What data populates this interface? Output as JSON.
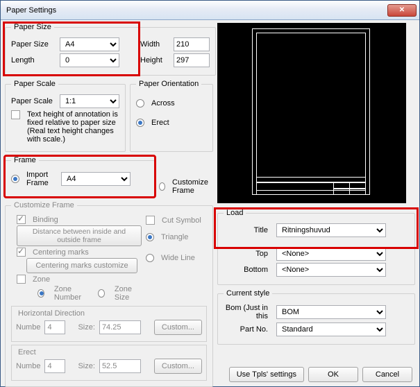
{
  "window": {
    "title": "Paper Settings"
  },
  "paperSize": {
    "legend": "Paper Size",
    "sizeLabel": "Paper Size",
    "sizeValue": "A4",
    "lengthLabel": "Length",
    "lengthValue": "0",
    "widthLabel": "Width",
    "widthValue": "210",
    "heightLabel": "Height",
    "heightValue": "297"
  },
  "paperScale": {
    "legend": "Paper Scale",
    "label": "Paper Scale",
    "value": "1:1",
    "note": "Text height of annotation is fixed relative to paper size (Real text height changes with scale.)"
  },
  "orientation": {
    "legend": "Paper Orientation",
    "across": "Across",
    "erect": "Erect"
  },
  "frame": {
    "legend": "Frame",
    "importLabel": "Import Frame",
    "importValue": "A4",
    "customizeLabel": "Customize Frame"
  },
  "customize": {
    "legend": "Customize Frame",
    "binding": "Binding",
    "distanceBtn": "Distance between inside and outside frame",
    "centering": "Centering marks",
    "centeringCustomize": "Centering marks customize",
    "zone": "Zone",
    "zoneNumber": "Zone Number",
    "zoneSize": "Zone Size",
    "hDir": "Horizontal Direction",
    "erect": "Erect",
    "numLabel": "Numbe",
    "sizeLabel": "Size:",
    "hNum": "4",
    "hSize": "74.25",
    "eNum": "4",
    "eSize": "52.5",
    "customBtn": "Custom...",
    "cutSymbol": "Cut Symbol",
    "triangle": "Triangle",
    "wideLine": "Wide Line"
  },
  "load": {
    "legend": "Load",
    "titleLabel": "Title",
    "titleValue": "Ritningshuvud",
    "topLabel": "Top",
    "topValue": "<None>",
    "bottomLabel": "Bottom",
    "bottomValue": "<None>"
  },
  "currentStyle": {
    "legend": "Current style",
    "bomLabel": "Bom (Just in this",
    "bomValue": "BOM",
    "partNoLabel": "Part No.",
    "partNoValue": "Standard"
  },
  "buttons": {
    "useTpls": "Use Tpls' settings",
    "ok": "OK",
    "cancel": "Cancel"
  }
}
